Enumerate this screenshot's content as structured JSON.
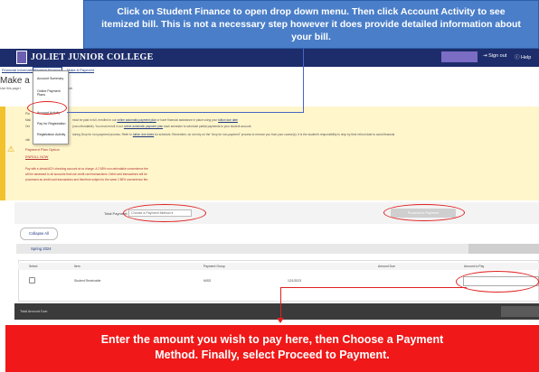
{
  "top_callout": {
    "line1": "Click on Student Finance to open drop down menu. Then click Account Activity to see",
    "line2": "itemized bill. This is not a necessary step however it does provide detailed information about",
    "line3": "your bill."
  },
  "header": {
    "logo": "JOLIET JUNIOR COLLEGE",
    "signout": "Sign out",
    "help": "Help"
  },
  "nav": {
    "financial_info": "Financial Information",
    "student_finance": "Student Finance",
    "make_payment": "Make A Payment"
  },
  "page": {
    "title": "Make a P",
    "subtitle": "Use this page t",
    "subtitle_tail": "account."
  },
  "dropdown": {
    "items": [
      "Account Summary",
      "Online Payment Plans",
      "Account Activity",
      "Pay for Registration",
      "Registration Activity"
    ]
  },
  "notice": {
    "frag1": "Pla",
    "frag2": "Mak",
    "frag3": "Onl",
    "line1": "must be paid in full, enrolled in our",
    "link1": "online automatic payment plan",
    "line1b": "or have financial assistance in place using your",
    "link1b": "tuition due date",
    "line2": "(non-refundable). You must enroll in our",
    "link2": "online automatic payment plan",
    "line2b": "each semester to schedule partial payments to your student account.",
    "line3a": "during Drop for non-payment process. Refer to",
    "link3": "tuition due dates",
    "line3b": "for schedule. Remember, do not rely on the \"drop for non-payment\" process to remove you from your course(s). It is the student's responsibility to drop by their refund date to avoid financial",
    "line3c": "obli",
    "options_title": "Payment Plan Option",
    "enroll": "ENROLL NOW",
    "fee1": "Pay with e-check/ACH checking account at no charge. A 2.85% non-refundable convenience fee",
    "fee2": "will be assessed to all accounts that use credit card transactions. Debit card transactions will be",
    "fee3": "processed as credit card transactions and therefore subject to the same 2.85% convenience fee."
  },
  "payment": {
    "total_label": "Total Payment:",
    "amount": "$0.00",
    "method_placeholder": "Choose a Payment Method",
    "proceed": "Proceed to Payment"
  },
  "collapse_label": "Collapse All",
  "term": "Spring 2024",
  "table": {
    "headers": [
      "Select",
      "Item",
      "Payment Group",
      "Amount Due",
      "Amount to Pay"
    ],
    "rows": [
      {
        "item": "Student Receivable",
        "group": "MISS",
        "due_date": "12/1/2023"
      }
    ]
  },
  "total_amount_due_label": "Total Amount Due:",
  "bottom_callout": {
    "line1": "Enter the amount you wish to pay here, then Choose a Payment",
    "line2": "Method. Finally,  select Proceed to Payment."
  },
  "colors": {
    "header_navy": "#1d2d6b",
    "callout_blue": "#4a7ec8",
    "callout_red": "#f01818",
    "notice_yellow": "#fff6cc"
  }
}
